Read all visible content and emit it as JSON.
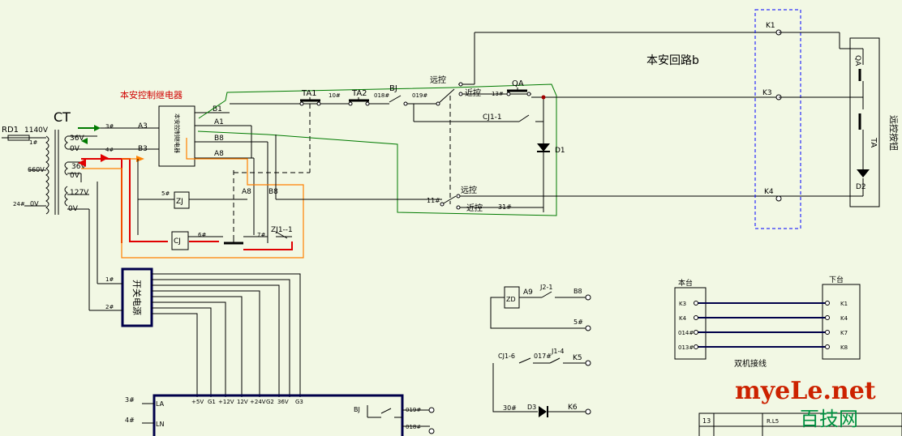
{
  "labels": {
    "ct": "CT",
    "rd1": "RD1",
    "v1140": "1140V",
    "v660": "660V",
    "v0_a": "0V",
    "n24": "24#",
    "n1_small": "1#",
    "v36_a": "36V",
    "v0_b": "0V",
    "v36_b": "36V",
    "v0_c": "0V",
    "v127": "127V",
    "v0_d": "0V",
    "relay_title": "本安控制继电器",
    "relay_box": "本安控制继电器",
    "n3": "3#",
    "n4": "4#",
    "a3": "A3",
    "b3": "B3",
    "b1": "B1",
    "a1": "A1",
    "b8": "B8",
    "a8": "A8",
    "a8_b": "A8",
    "b8_b": "B8",
    "n5": "5#",
    "zj": "ZJ",
    "cj": "CJ",
    "n6": "6#",
    "n7": "7#",
    "zj1": "ZJ1--1",
    "ta1": "TA1",
    "n10": "10#",
    "ta2": "TA2",
    "n018": "018#",
    "bj": "BJ",
    "n019": "019#",
    "remote1": "远控",
    "near1": "近控",
    "n13": "13#",
    "qa": "QA",
    "cj11": "CJ1-1",
    "d1": "D1",
    "n11": "11#",
    "remote2": "远控",
    "near2": "近控",
    "n31": "31#",
    "k1": "K1",
    "k3": "K3",
    "k4": "K4",
    "loop": "本安回路b",
    "qa_r": "QA",
    "ta_r": "TA",
    "remote_btn": "远控按钮",
    "d2": "D2",
    "psu": "开关电源",
    "n1": "1#",
    "n2": "2#",
    "rails": [
      "+5V",
      "G1",
      "+12V",
      "12V",
      "+24V",
      "G2",
      "36V",
      "G3"
    ],
    "n3b": "3#",
    "n4b": "4#",
    "la": "LA",
    "ln": "LN",
    "bj2": "BJ",
    "n019b": "019#",
    "n018b": "018#",
    "zd": "ZD",
    "a9": "A9",
    "j2": "J2-1",
    "b8c": "B8",
    "n5b": "5#",
    "cj16": "CJ1-6",
    "n017": "017#",
    "j14": "J1-4",
    "k5": "K5",
    "n30": "30#",
    "d3": "D3",
    "k6": "K6",
    "ben": "本台",
    "xia": "下台",
    "left_terms": [
      "K3",
      "K4",
      "014#",
      "013#"
    ],
    "right_terms": [
      "K1",
      "K4",
      "K7",
      "K8"
    ],
    "dual": "双机接线",
    "watermark1": "myeLe.net",
    "watermark2": "百技网",
    "tbl_13": "13",
    "tbl_b": "R.L5"
  },
  "colors": {
    "wire": "#000000",
    "blue": "#0000ff",
    "green_loop": "#007a00",
    "red_wire": "#e00000",
    "orange_wire": "#ff8000",
    "watermark_red": "#cc2200",
    "watermark_green": "#009040"
  }
}
